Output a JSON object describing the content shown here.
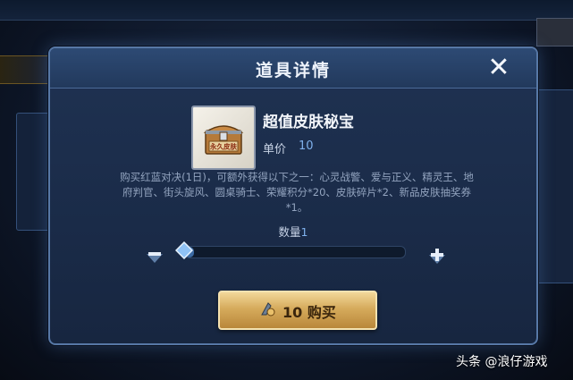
{
  "dialog": {
    "title": "道具详情",
    "close_icon": "close-icon"
  },
  "item": {
    "icon": "treasure-chest-icon",
    "badge_text": "永久皮肤",
    "name": "超值皮肤秘宝",
    "price_label": "单价",
    "price_value": "10",
    "description": "购买红蓝对决(1日)，可额外获得以下之一：心灵战警、爱与正义、精灵王、地府判官、街头旋风、圆桌骑士、荣耀积分*20、皮肤碎片*2、新品皮肤抽奖券*1。"
  },
  "quantity": {
    "label": "数量",
    "value": "1",
    "fraction": 0.02
  },
  "buy_button": {
    "icon": "coupon-icon",
    "label": "10 购买"
  },
  "watermark": "头条 @浪仔游戏",
  "colors": {
    "accent_blue": "#7fb1ec",
    "button_gold": "#d6ab5c",
    "panel_border": "#5778a6"
  }
}
